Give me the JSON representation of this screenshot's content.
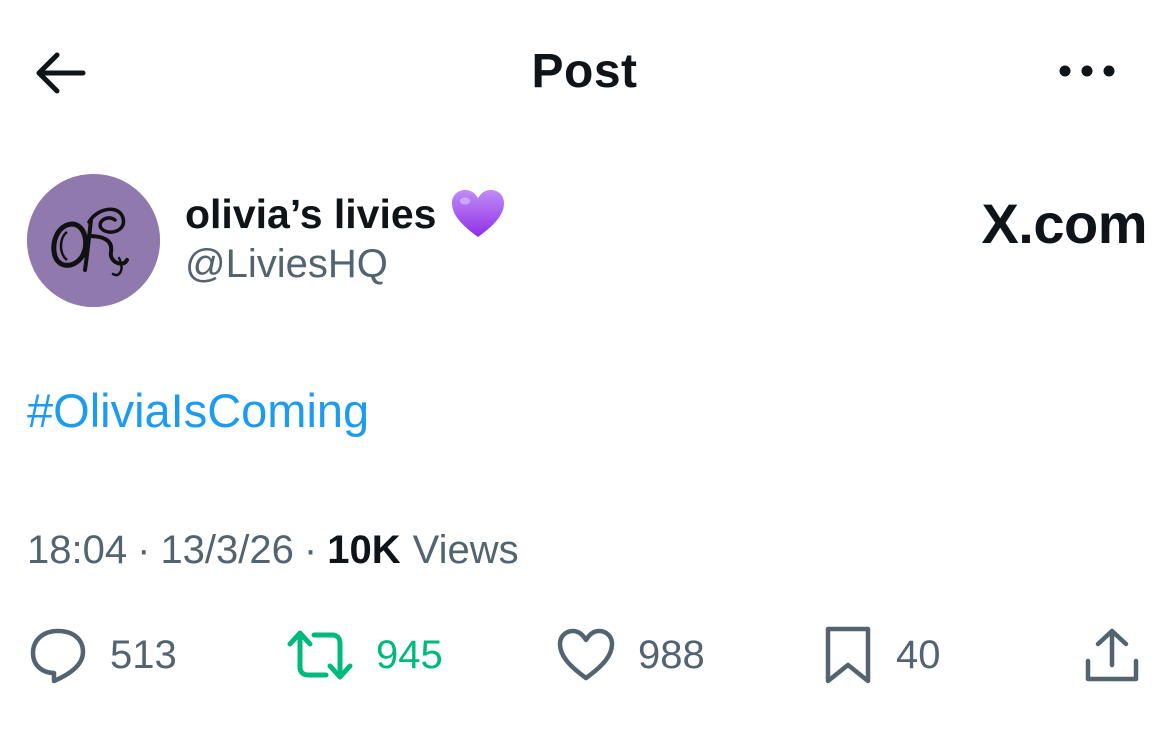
{
  "header": {
    "title": "Post",
    "back_icon": "arrow-left-icon",
    "more_icon": "ellipsis-icon"
  },
  "author": {
    "display_name": "olivia’s livies",
    "name_emoji": "purple-heart-icon",
    "handle": "@LiviesHQ",
    "avatar_color": "#9079ad"
  },
  "watermark": {
    "text": "X.com"
  },
  "post": {
    "text": "#OliviaIsComing",
    "link_color": "#1d9bf0"
  },
  "meta": {
    "time": "18:04",
    "date": "13/3/26",
    "views_count": "10K",
    "views_label": "Views"
  },
  "actions": {
    "replies": "513",
    "reposts": "945",
    "likes": "988",
    "bookmarks": "40",
    "repost_color": "#00ba7c",
    "icon_color": "#536471"
  }
}
